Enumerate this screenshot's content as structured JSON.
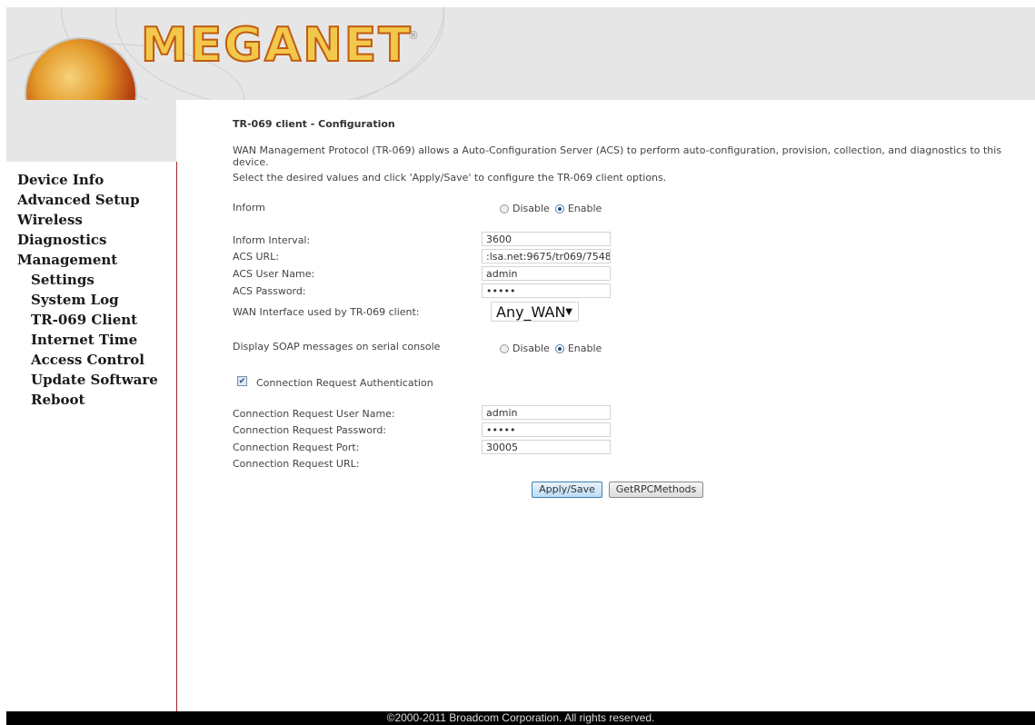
{
  "header": {
    "logo_text": "MEGANET",
    "logo_reg": "®"
  },
  "sidebar": {
    "items": [
      {
        "label": "Device Info"
      },
      {
        "label": "Advanced Setup"
      },
      {
        "label": "Wireless"
      },
      {
        "label": "Diagnostics"
      },
      {
        "label": "Management"
      }
    ],
    "sub_items": [
      {
        "label": "Settings"
      },
      {
        "label": "System Log"
      },
      {
        "label": "TR-069 Client"
      },
      {
        "label": "Internet Time"
      },
      {
        "label": "Access Control"
      },
      {
        "label": "Update Software"
      },
      {
        "label": "Reboot"
      }
    ]
  },
  "main": {
    "title": "TR-069 client - Configuration",
    "description": "WAN Management Protocol (TR-069) allows a Auto-Configuration Server (ACS) to perform auto-configuration, provision, collection, and diagnostics to this device.",
    "instruction": "Select the desired values and click 'Apply/Save' to configure the TR-069 client options.",
    "inform": {
      "label": "Inform",
      "disable": "Disable",
      "enable": "Enable",
      "selected": "Enable"
    },
    "inform_interval": {
      "label": "Inform Interval:",
      "value": "3600"
    },
    "acs_url": {
      "label": "ACS URL:",
      "value": ":lsa.net:9675/tr069/7548"
    },
    "acs_user": {
      "label": "ACS User Name:",
      "value": "admin"
    },
    "acs_password": {
      "label": "ACS Password:",
      "value": "•••••"
    },
    "wan_interface": {
      "label": "WAN Interface used by TR-069 client:",
      "value": "Any_WAN"
    },
    "soap": {
      "label": "Display SOAP messages on serial console",
      "disable": "Disable",
      "enable": "Enable",
      "selected": "Enable"
    },
    "conn_auth": {
      "label": "Connection Request Authentication",
      "checked": true
    },
    "conn_user": {
      "label": "Connection Request User Name:",
      "value": "admin"
    },
    "conn_password": {
      "label": "Connection Request Password:",
      "value": "•••••"
    },
    "conn_port": {
      "label": "Connection Request Port:",
      "value": "30005"
    },
    "conn_url": {
      "label": "Connection Request URL:"
    },
    "apply_label": "Apply/Save",
    "rpc_label": "GetRPCMethods"
  },
  "footer": {
    "text": "©2000-2011 Broadcom Corporation. All rights reserved."
  }
}
